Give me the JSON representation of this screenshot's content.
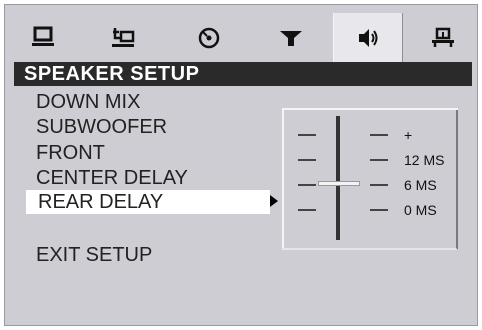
{
  "tabs": [
    {
      "icon": "monitor-icon",
      "active": false
    },
    {
      "icon": "language-setup-icon",
      "active": false
    },
    {
      "icon": "disc-icon",
      "active": false
    },
    {
      "icon": "video-settings-icon",
      "active": false
    },
    {
      "icon": "speaker-icon",
      "active": true
    },
    {
      "icon": "preferences-icon",
      "active": false
    }
  ],
  "header": {
    "title": "SPEAKER SETUP"
  },
  "menu": {
    "items": [
      {
        "label": "DOWN MIX"
      },
      {
        "label": "SUBWOOFER"
      },
      {
        "label": "FRONT"
      },
      {
        "label": "CENTER DELAY"
      },
      {
        "label": "REAR DELAY",
        "selected": true
      },
      {
        "label": "EXIT SETUP"
      }
    ]
  },
  "slider": {
    "labels": [
      "+",
      "12 MS",
      "6 MS",
      "0 MS"
    ],
    "value": "6 MS"
  },
  "colors": {
    "background": "#cdcdd3",
    "title_bar": "#2a2a2a",
    "selected_row": "#ffffff",
    "active_tab": "#e8e8ec"
  }
}
